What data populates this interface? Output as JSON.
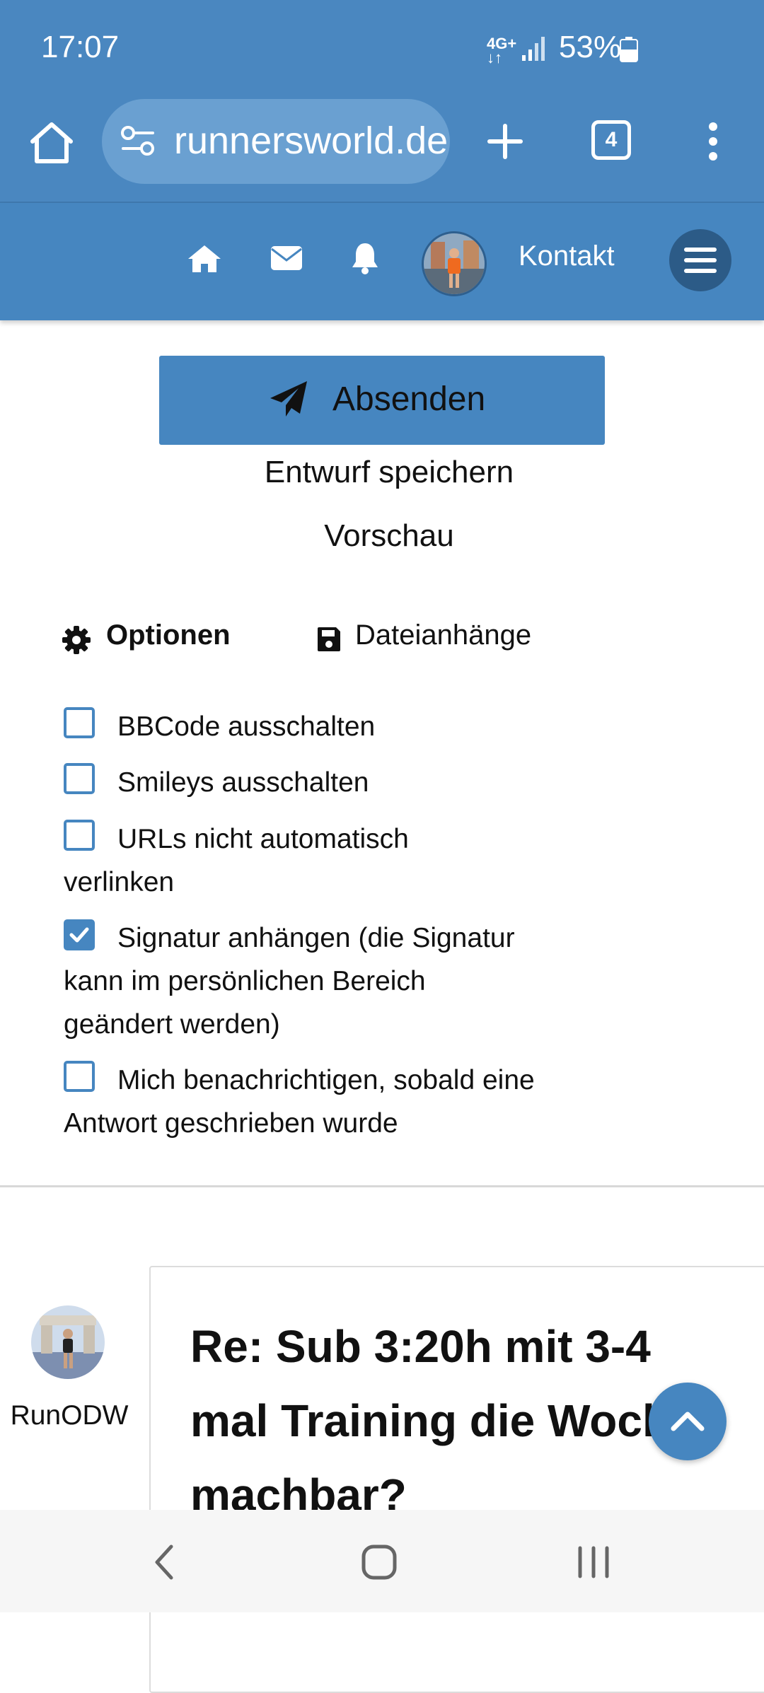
{
  "status_bar": {
    "time": "17:07",
    "network": "4G+",
    "battery": "53%"
  },
  "browser": {
    "url": "runnersworld.de",
    "tab_count": "4",
    "icons": [
      "home-icon",
      "site-settings-icon",
      "new-tab-icon",
      "tabs-icon",
      "more-vert-icon"
    ]
  },
  "site_nav": {
    "contact": "Kontakt",
    "icons": [
      "home-icon",
      "mail-icon",
      "bell-icon",
      "avatar",
      "hamburger-menu-icon"
    ]
  },
  "actions": {
    "submit": "Absenden",
    "save_draft": "Entwurf speichern",
    "preview": "Vorschau"
  },
  "tabs": {
    "options": "Optionen",
    "attachments": "Dateianhänge"
  },
  "options": [
    {
      "label": "BBCode ausschalten",
      "checked": false
    },
    {
      "label": "Smileys ausschalten",
      "checked": false
    },
    {
      "label": "URLs nicht automatisch verlinken",
      "checked": false
    },
    {
      "label": "Signatur anhängen (die Signatur kann im persönlichen Bereich geändert werden)",
      "checked": true
    },
    {
      "label": "Mich benachrichtigen, sobald eine Antwort geschrieben wurde",
      "checked": false
    }
  ],
  "post": {
    "author": "RunODW",
    "title": "Re: Sub 3:20h mit 3-4 mal Training die Woche machbar?"
  },
  "colors": {
    "primary": "#4686c0",
    "chrome": "#4a87c0",
    "menu_button": "#2c5b87"
  }
}
